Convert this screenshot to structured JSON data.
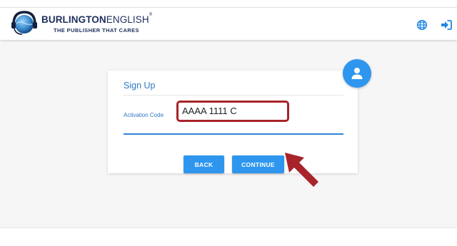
{
  "brand": {
    "name_bold": "BURLINGTON",
    "name_thin": "ENGLISH",
    "trademark": "®",
    "tagline": "THE PUBLISHER THAT CARES"
  },
  "header": {
    "icons": [
      "globe-icon",
      "login-icon"
    ]
  },
  "form": {
    "title": "Sign Up",
    "activation_label": "Activation Code",
    "activation_value": "AAAA 1111 C",
    "back_label": "BACK",
    "continue_label": "CONTINUE"
  },
  "avatar_icon": "user-icon",
  "colors": {
    "accent": "#2e96ee",
    "brand_navy": "#1e2f5c",
    "annotation_red": "#a8232a"
  }
}
